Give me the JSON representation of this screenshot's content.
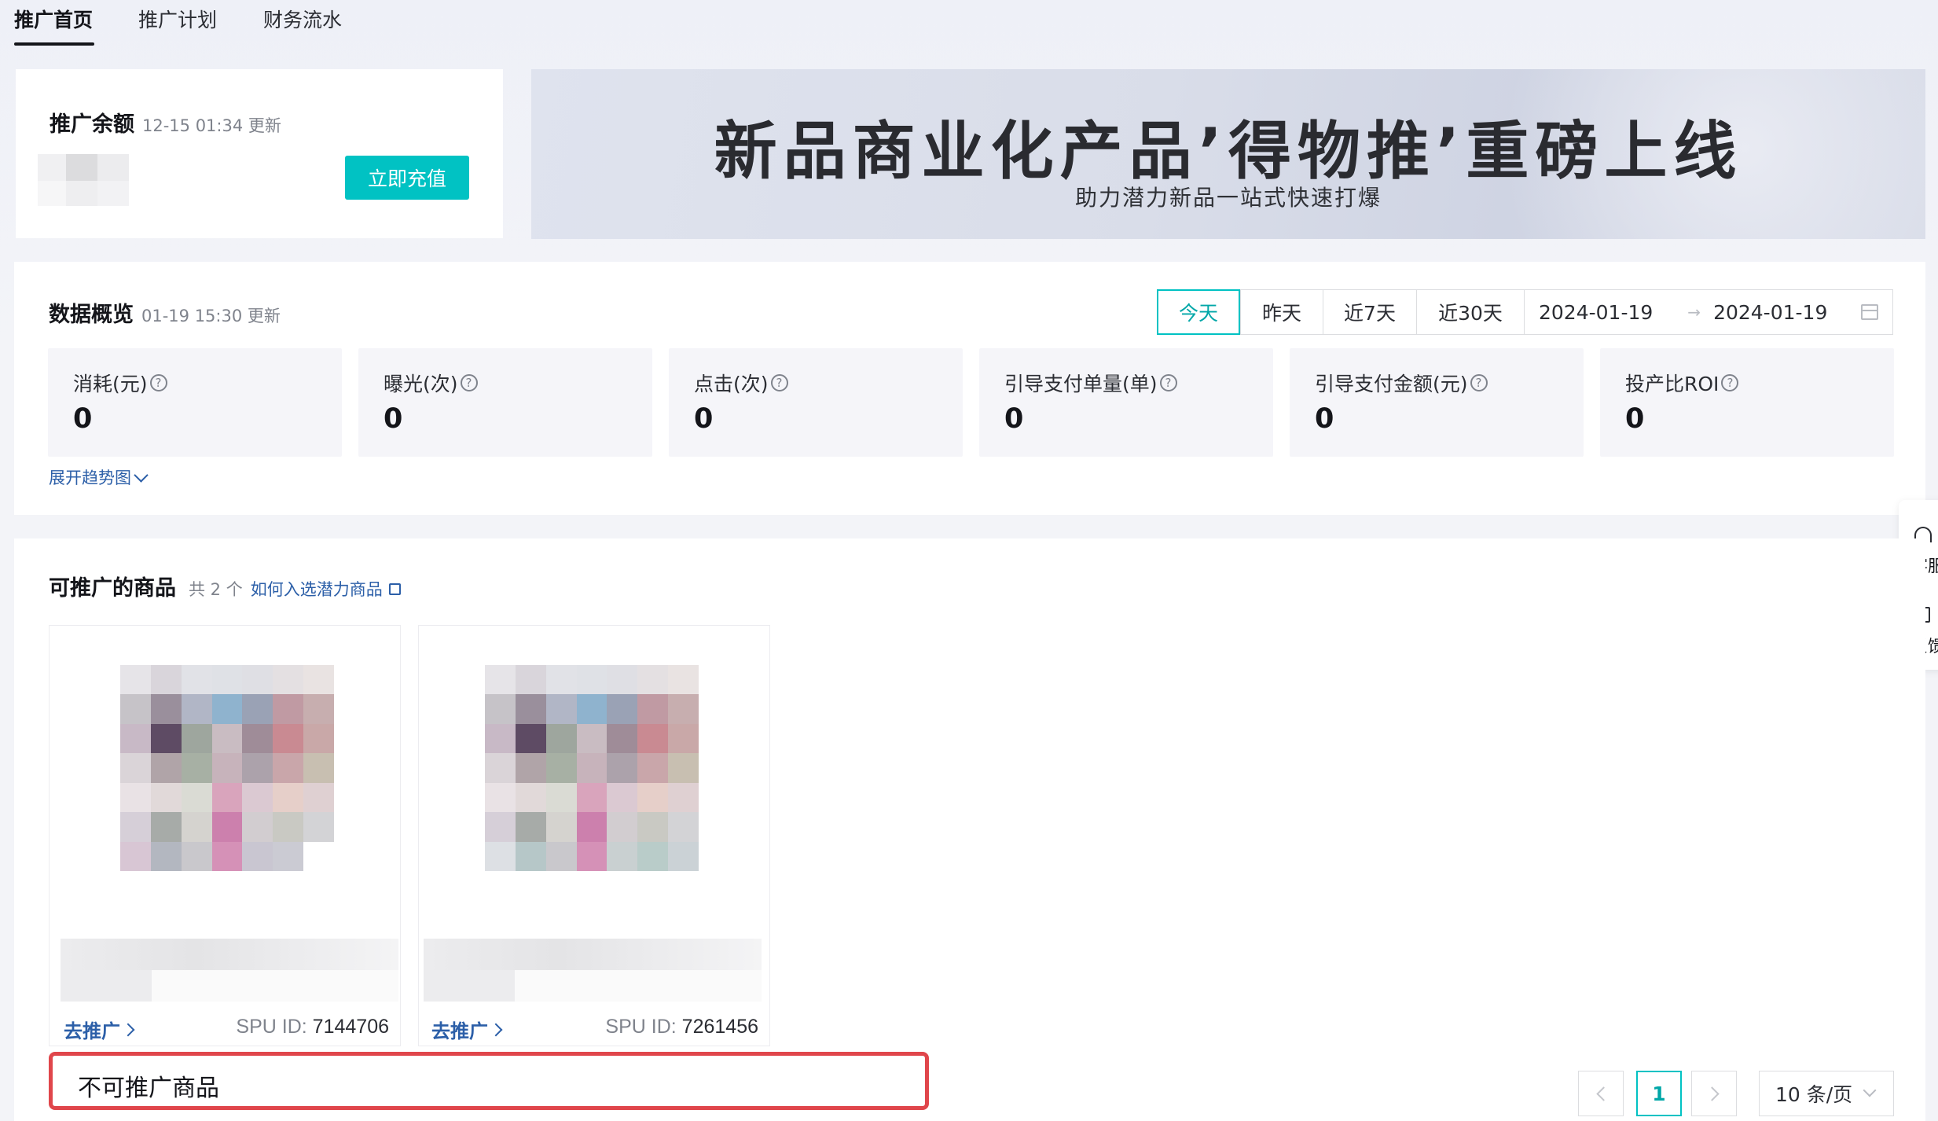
{
  "nav": {
    "tabs": [
      {
        "label": "推广首页",
        "active": true
      },
      {
        "label": "推广计划",
        "active": false
      },
      {
        "label": "财务流水",
        "active": false
      }
    ]
  },
  "balance": {
    "title": "推广余额",
    "updated": "12-15 01:34 更新",
    "recharge_label": "立即充值"
  },
  "banner": {
    "title": "新品商业化产品’得物推’重磅上线",
    "subtitle": "助力潜力新品一站式快速打爆"
  },
  "overview": {
    "title": "数据概览",
    "updated": "01-19 15:30 更新",
    "ranges": [
      "今天",
      "昨天",
      "近7天",
      "近30天"
    ],
    "active_range": "今天",
    "date_start": "2024-01-19",
    "date_sep": "→",
    "date_end": "2024-01-19",
    "metrics": [
      {
        "label": "消耗(元)",
        "value": "0"
      },
      {
        "label": "曝光(次)",
        "value": "0"
      },
      {
        "label": "点击(次)",
        "value": "0"
      },
      {
        "label": "引导支付单量(单)",
        "value": "0"
      },
      {
        "label": "引导支付金额(元)",
        "value": "0"
      },
      {
        "label": "投产比ROI",
        "value": "0"
      }
    ],
    "expand_label": "展开趋势图"
  },
  "products": {
    "title": "可推广的商品",
    "count_text": "共 2 个",
    "help_link": "如何入选潜力商品",
    "items": [
      {
        "promote_label": "去推广",
        "spu_label": "SPU ID:",
        "spu_id": "7144706"
      },
      {
        "promote_label": "去推广",
        "spu_label": "SPU ID:",
        "spu_id": "7261456"
      }
    ],
    "non_promotable_label": "不可推广商品"
  },
  "pagination": {
    "current_page": "1",
    "page_size": "10 条/页"
  },
  "side_float": {
    "items": [
      {
        "label": "客服",
        "icon": "headset-icon"
      },
      {
        "label": "反馈",
        "icon": "feedback-icon"
      }
    ]
  },
  "colors": {
    "accent": "#01c2c3",
    "link": "#2c5fa8",
    "highlight_border": "#e0464b"
  }
}
